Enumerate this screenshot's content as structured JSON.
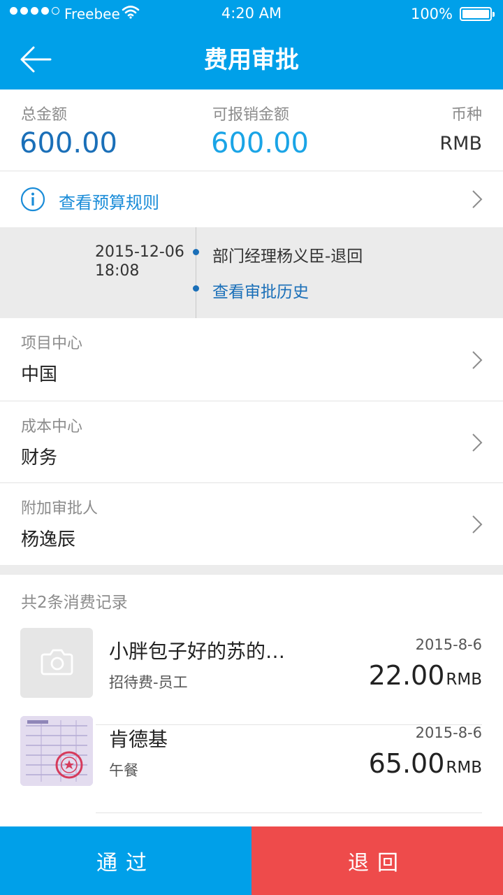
{
  "status_bar": {
    "carrier": "Freebee",
    "time": "4:20 AM",
    "battery": "100%"
  },
  "header": {
    "title": "费用审批",
    "back_icon": "arrow-left-icon"
  },
  "summary": {
    "total_label": "总金额",
    "total_value": "600.00",
    "reimbursable_label": "可报销金额",
    "reimbursable_value": "600.00",
    "currency_label": "币种",
    "currency_value": "RMB"
  },
  "budget": {
    "label": "查看预算规则",
    "icon": "info-icon"
  },
  "timeline": {
    "date": "2015-12-06",
    "time": "18:08",
    "status": "部门经理杨义臣-退回",
    "history_link": "查看审批历史"
  },
  "fields": [
    {
      "label": "项目中心",
      "value": "中国"
    },
    {
      "label": "成本中心",
      "value": "财务"
    },
    {
      "label": "附加审批人",
      "value": "杨逸辰"
    }
  ],
  "records": {
    "title": "共2条消费记录",
    "items": [
      {
        "name": "小胖包子好的苏的…",
        "category": "招待费-员工",
        "date": "2015-8-6",
        "amount": "22.00",
        "currency": "RMB",
        "thumb": "camera-icon"
      },
      {
        "name": "肯德基",
        "category": "午餐",
        "date": "2015-8-6",
        "amount": "65.00",
        "currency": "RMB",
        "thumb": "receipt-image"
      }
    ]
  },
  "actions": {
    "approve": "通过",
    "reject": "退回"
  },
  "colors": {
    "primary": "#00a0e9",
    "reject": "#ee4b4b",
    "total_amount": "#1a6fb8",
    "reimbursable_amount": "#1aa4e6"
  }
}
